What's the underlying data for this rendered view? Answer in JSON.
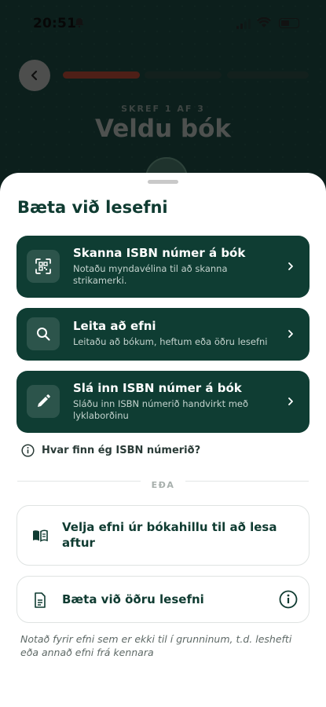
{
  "status_bar": {
    "time": "20:51"
  },
  "header": {
    "step_label": "SKREF 1 AF 3",
    "title": "Veldu bók",
    "progress": {
      "total_steps": 3,
      "current_step": 1
    }
  },
  "sheet": {
    "title": "Bæta við lesefni",
    "primary_options": [
      {
        "title": "Skanna ISBN númer á bók",
        "subtitle": "Notaðu myndavélina til að skanna strikamerki.",
        "icon": "barcode-scan-icon"
      },
      {
        "title": "Leita að efni",
        "subtitle": "Leitaðu að bókum, heftum eða öðru lesefni",
        "icon": "search-icon"
      },
      {
        "title": "Slá inn ISBN númer á bók",
        "subtitle": "Sláðu inn ISBN númerið handvirkt með lyklaborðinu",
        "icon": "pencil-icon"
      }
    ],
    "help_link": "Hvar finn ég ISBN númerið?",
    "divider_label": "EÐA",
    "secondary_options": [
      {
        "title": "Velja efni úr bókahillu til að lesa aftur",
        "icon": "book-icon"
      },
      {
        "title": "Bæta við öðru lesefni",
        "icon": "document-icon"
      }
    ],
    "footnote": "Notað fyrir efni sem er ekki til í grunninum, t.d. leshefti eða annað efni frá kennara"
  },
  "colors": {
    "primary": "#0f3d33",
    "accent": "#8e3a2a",
    "sheet_bg": "#ffffff"
  }
}
